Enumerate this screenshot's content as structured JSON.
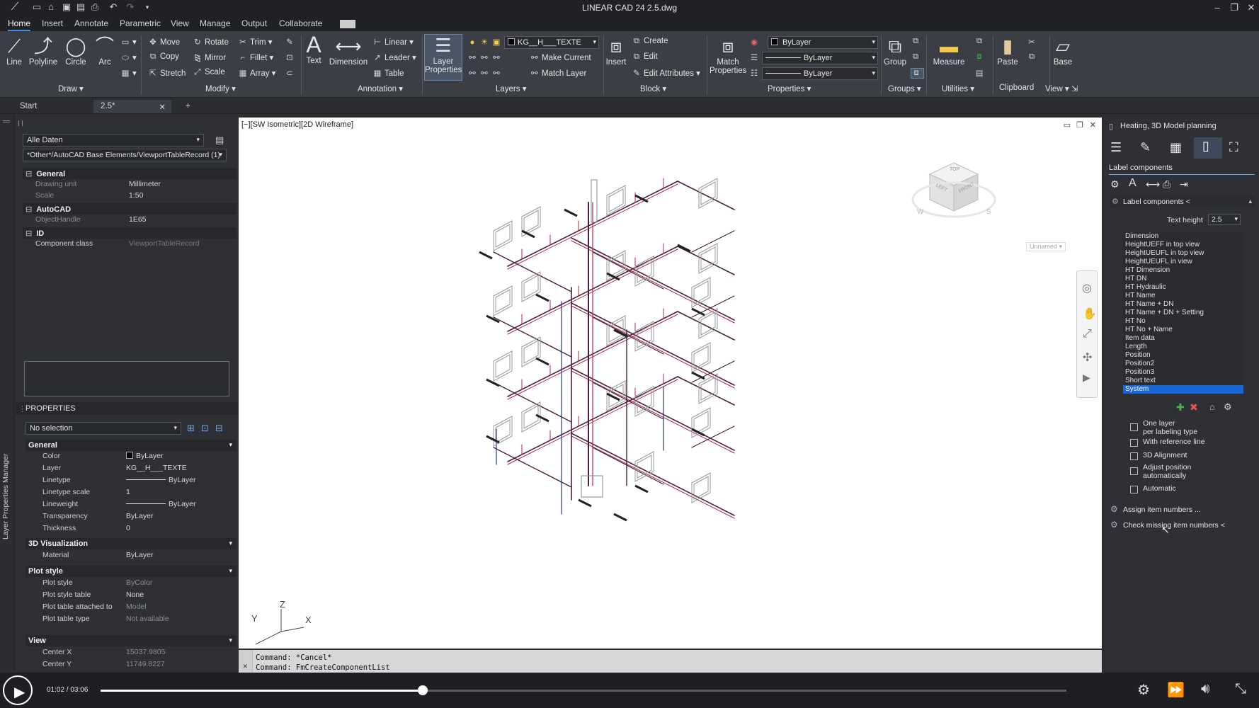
{
  "window": {
    "title": "LINEAR CAD 24   2.5.dwg"
  },
  "menu": {
    "items": [
      "Home",
      "Insert",
      "Annotate",
      "Parametric",
      "View",
      "Manage",
      "Output",
      "Collaborate"
    ]
  },
  "ribbon": {
    "draw": {
      "line": "Line",
      "polyline": "Polyline",
      "circle": "Circle",
      "arc": "Arc",
      "group": "Draw"
    },
    "modify": {
      "move": "Move",
      "rotate": "Rotate",
      "trim": "Trim",
      "copy": "Copy",
      "mirror": "Mirror",
      "fillet": "Fillet",
      "stretch": "Stretch",
      "scale": "Scale",
      "array": "Array",
      "group": "Modify"
    },
    "annotation": {
      "text": "Text",
      "dimension": "Dimension",
      "linear": "Linear",
      "leader": "Leader",
      "table": "Table",
      "group": "Annotation"
    },
    "layers": {
      "layer_properties_1": "Layer",
      "layer_properties_2": "Properties",
      "layer_combo": "KG__H___TEXTE",
      "make_current": "Make Current",
      "match_layer": "Match Layer",
      "group": "Layers"
    },
    "block": {
      "insert": "Insert",
      "create": "Create",
      "edit": "Edit",
      "edit_attributes": "Edit Attributes",
      "group": "Block"
    },
    "properties": {
      "match_1": "Match",
      "match_2": "Properties",
      "color_combo": "ByLayer",
      "linetype_combo": "ByLayer",
      "lineweight_combo": "ByLayer",
      "group": "Properties"
    },
    "groups": {
      "group_btn": "Group",
      "group": "Groups"
    },
    "utilities": {
      "measure": "Measure",
      "group": "Utilities"
    },
    "clipboard": {
      "paste": "Paste",
      "group": "Clipboard"
    },
    "view": {
      "base": "Base",
      "group": "View"
    }
  },
  "tabs": {
    "start": "Start",
    "doc": "2.5*"
  },
  "leftpanel": {
    "side_label": "Layer Properties Manager",
    "filter_combo": "Alle Daten",
    "record_combo": "*Other*/AutoCAD Base Elements/ViewportTableRecord (1)",
    "sections": {
      "general": "General",
      "drawing_unit_k": "Drawing unit",
      "drawing_unit_v": "Millimeter",
      "scale_k": "Scale",
      "scale_v": "1:50",
      "autocad": "AutoCAD",
      "handle_k": "ObjectHandle",
      "handle_v": "1E65",
      "id": "ID",
      "component_class_k": "Component class",
      "component_class_v": "ViewportTableRecord"
    },
    "properties_title": "PROPERTIES",
    "selection_combo": "No selection",
    "props": {
      "general": "General",
      "color_k": "Color",
      "color_v": "ByLayer",
      "layer_k": "Layer",
      "layer_v": "KG__H___TEXTE",
      "linetype_k": "Linetype",
      "linetype_v": "ByLayer",
      "linetype_scale_k": "Linetype scale",
      "linetype_scale_v": "1",
      "lineweight_k": "Lineweight",
      "lineweight_v": "ByLayer",
      "transparency_k": "Transparency",
      "transparency_v": "ByLayer",
      "thickness_k": "Thickness",
      "thickness_v": "0",
      "viz3d": "3D Visualization",
      "material_k": "Material",
      "material_v": "ByLayer",
      "plot": "Plot style",
      "plot_style_k": "Plot style",
      "plot_style_v": "ByColor",
      "plot_table_k": "Plot style table",
      "plot_table_v": "None",
      "plot_attached_k": "Plot table attached to",
      "plot_attached_v": "Model",
      "plot_type_k": "Plot table type",
      "plot_type_v": "Not available",
      "view": "View",
      "center_x_k": "Center X",
      "center_x_v": "15037.9805",
      "center_y_k": "Center Y",
      "center_y_v": "11749.8227"
    }
  },
  "viewport": {
    "label": "[−][SW Isometric][2D Wireframe]",
    "viewcube": {
      "top": "TOP",
      "left": "LEFT",
      "front": "FRONT",
      "compass_w": "W",
      "compass_s": "S",
      "unnamed": "Unnamed"
    },
    "ucs": {
      "x": "X",
      "y": "Y",
      "z": "Z"
    }
  },
  "command": {
    "line1": "Command: *Cancel*",
    "line2": "Command: FmCreateComponentList"
  },
  "rightpanel": {
    "title": "Heating, 3D Model planning",
    "section": "Label components",
    "subsection": "Label components <",
    "text_height_label": "Text height",
    "text_height_value": "2.5",
    "list": [
      "Dimension",
      "HeightUEFF in top view",
      "HeightUEUFL in top view",
      "HeightUEUFL in view",
      "HT Dimension",
      "HT DN",
      "HT Hydraulic",
      "HT Name",
      "HT Name + DN",
      "HT Name + DN + Setting",
      "HT No",
      "HT No + Name",
      "Item data",
      "Length",
      "Position",
      "Position2",
      "Position3",
      "Short text",
      "System"
    ],
    "selected_index": 18,
    "checks": {
      "one_layer_1": "One layer",
      "one_layer_2": "per labeling type",
      "reference": "With reference line",
      "alignment": "3D Alignment",
      "adjust_1": "Adjust position",
      "adjust_2": "automatically",
      "automatic": "Automatic"
    },
    "assign": "Assign item numbers ...",
    "check_missing": "Check missing item numbers <"
  },
  "player": {
    "time": "01:02 / 03:06",
    "progress": 0.3333
  }
}
